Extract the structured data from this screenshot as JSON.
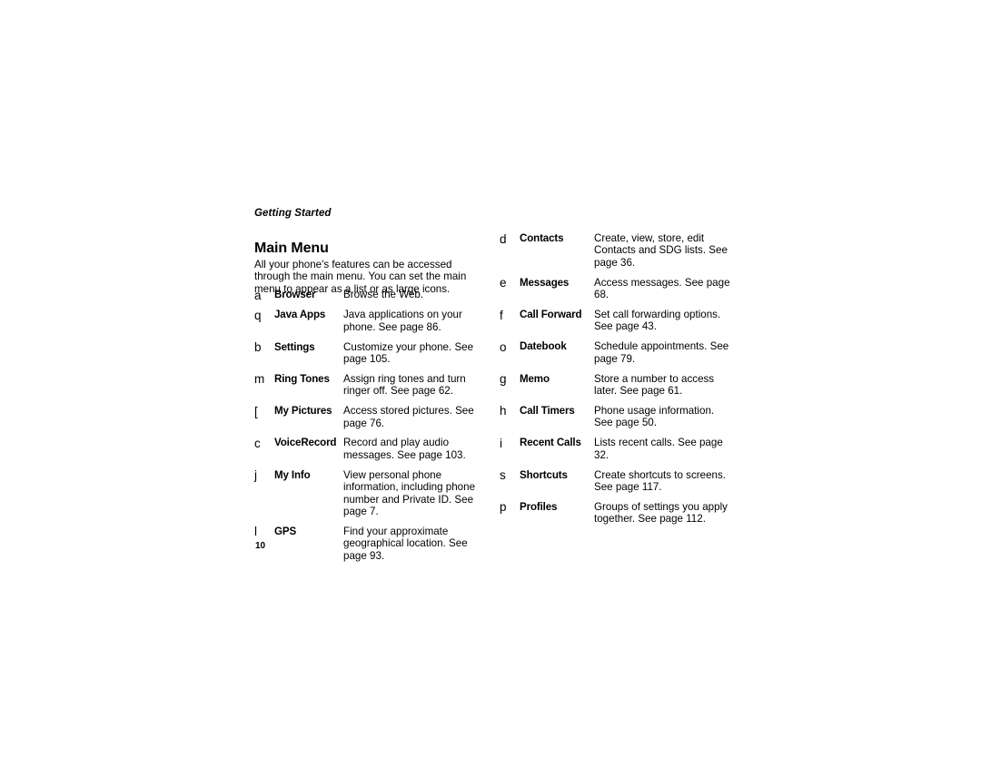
{
  "running_head": "Getting Started",
  "section_title": "Main Menu",
  "intro": "All your phone's features can be accessed through the main menu. You can set the main menu to appear as a list or as large icons.",
  "folio": "10",
  "menu": {
    "left_column": [
      {
        "icon": "a",
        "label": "Browser",
        "desc": "Browse the Web."
      },
      {
        "icon": "q",
        "label": "Java Apps",
        "desc": "Java applications on your phone. See page 86."
      },
      {
        "icon": "b",
        "label": "Settings",
        "desc": "Customize your phone. See page 105."
      },
      {
        "icon": "m",
        "label": "Ring Tones",
        "desc": "Assign ring tones and turn ringer off. See page 62."
      },
      {
        "icon": "[",
        "label": "My Pictures",
        "desc": "Access stored pictures. See page 76."
      },
      {
        "icon": "c",
        "label": "VoiceRecord",
        "desc": "Record and play audio messages. See page 103."
      },
      {
        "icon": "j",
        "label": "My Info",
        "desc": "View personal phone information, including phone number and Private ID. See page 7."
      },
      {
        "icon": "l",
        "label": "GPS",
        "desc": "Find your approximate geographical location. See page 93."
      }
    ],
    "right_column": [
      {
        "icon": "d",
        "label": "Contacts",
        "desc": "Create, view, store, edit Contacts and SDG lists. See page 36."
      },
      {
        "icon": "e",
        "label": "Messages",
        "desc": "Access messages. See page 68."
      },
      {
        "icon": "f",
        "label": "Call Forward",
        "desc": "Set call forwarding options. See page 43."
      },
      {
        "icon": "o",
        "label": "Datebook",
        "desc": "Schedule appointments. See page 79."
      },
      {
        "icon": "g",
        "label": "Memo",
        "desc": "Store a number to access later. See page 61."
      },
      {
        "icon": "h",
        "label": "Call Timers",
        "desc": "Phone usage information. See page 50."
      },
      {
        "icon": "i",
        "label": "Recent Calls",
        "desc": "Lists recent calls. See page 32."
      },
      {
        "icon": "s",
        "label": "Shortcuts",
        "desc": "Create shortcuts to screens. See page 117."
      },
      {
        "icon": "p",
        "label": "Profiles",
        "desc": "Groups of settings you apply together. See page 112."
      }
    ]
  }
}
